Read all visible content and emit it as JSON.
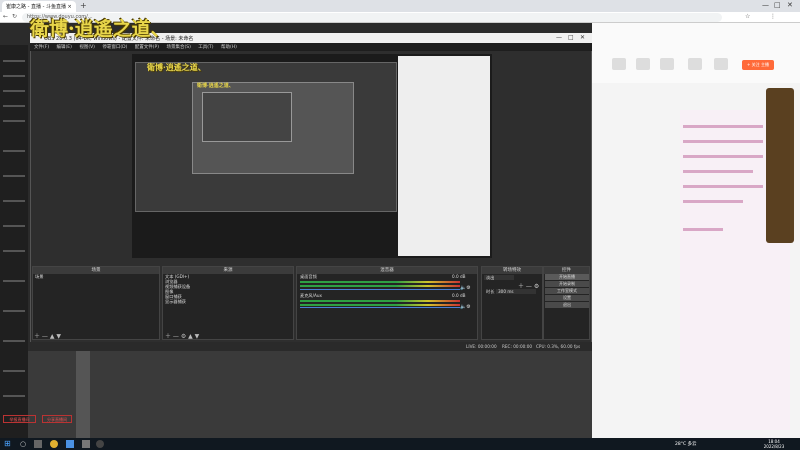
{
  "browser": {
    "tab_title": "崔康之路 - 直播 - 斗鱼直播 ×",
    "address": "https://www.douyu.com/...",
    "window_controls": [
      "—",
      "□",
      "✕"
    ]
  },
  "watermark": "衛博·逍遙之道、",
  "obs": {
    "title": "OBS 28.0.3 (64-bit, windows) - 配置文件: 未命名 - 场景: 未命名",
    "menu": [
      "文件(F)",
      "编辑(E)",
      "视图(V)",
      "停靠窗口(D)",
      "配置文件(P)",
      "场景集合(S)",
      "工具(T)",
      "帮助(H)"
    ],
    "inner_watermark": "衛博·逍遙之道、",
    "docks": {
      "scenes": {
        "title": "场景",
        "items": [
          "场景"
        ]
      },
      "sources": {
        "title": "来源",
        "items": [
          "文本 (GDI+)",
          "浏览器",
          "视频捕获设备",
          "图像",
          "窗口捕获",
          "显示器捕获"
        ]
      },
      "mixer": {
        "title": "混音器",
        "tracks": [
          {
            "name": "桌面音频",
            "db": "0.0 dB"
          },
          {
            "name": "麦克风/Aux",
            "db": "0.0 dB"
          }
        ]
      },
      "transitions": {
        "title": "转场特效",
        "type": "淡出",
        "duration_label": "时长",
        "duration": "300 ms"
      },
      "controls": {
        "title": "控件",
        "buttons": [
          "开始直播",
          "开始录制",
          "工作室模式",
          "设置",
          "退出"
        ]
      }
    },
    "status": {
      "live": "LIVE: 00:00:00",
      "rec": "REC: 00:00:00",
      "cpu": "CPU: 0.3%, 60.00 fps"
    }
  },
  "page": {
    "low_buttons": [
      "举报直播间",
      "分享直播间"
    ],
    "follow": "+ 关注 主播"
  },
  "taskbar": {
    "temperature": "28°C 多云",
    "time": "18:04",
    "date": "2022/8/23"
  }
}
